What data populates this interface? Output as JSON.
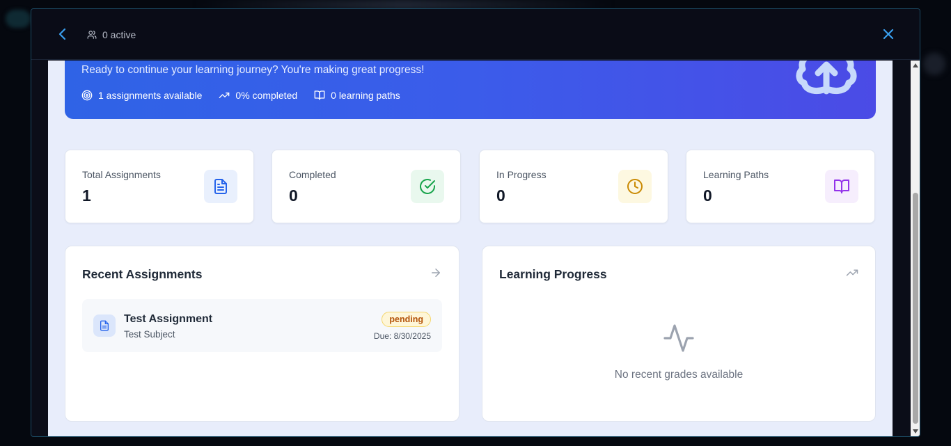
{
  "header": {
    "active_text": "0 active",
    "icons": [
      "chevron-left-icon",
      "users-icon",
      "close-icon"
    ]
  },
  "hero": {
    "subtitle": "Ready to continue your learning journey? You're making great progress!",
    "stats": [
      {
        "icon": "target-icon",
        "text": "1 assignments available"
      },
      {
        "icon": "trending-up-icon",
        "text": "0% completed"
      },
      {
        "icon": "book-open-icon",
        "text": "0 learning paths"
      }
    ],
    "decor_icon": "brain-icon"
  },
  "stat_cards": [
    {
      "label": "Total Assignments",
      "value": "1",
      "icon": "file-text-icon",
      "icon_color": "#2563eb",
      "icon_bg": "#e9f0fd"
    },
    {
      "label": "Completed",
      "value": "0",
      "icon": "check-circle-icon",
      "icon_color": "#16a34a",
      "icon_bg": "#e9f8ee"
    },
    {
      "label": "In Progress",
      "value": "0",
      "icon": "clock-icon",
      "icon_color": "#ca8a04",
      "icon_bg": "#fdf8e1"
    },
    {
      "label": "Learning Paths",
      "value": "0",
      "icon": "book-open-icon",
      "icon_color": "#9333ea",
      "icon_bg": "#f6eefd"
    }
  ],
  "recent_assignments": {
    "title": "Recent Assignments",
    "items": [
      {
        "title": "Test Assignment",
        "subject": "Test Subject",
        "status": "pending",
        "due": "Due: 8/30/2025"
      }
    ]
  },
  "learning_progress": {
    "title": "Learning Progress",
    "empty_text": "No recent grades available"
  },
  "colors": {
    "accent": "#2f63e6",
    "header_bg": "#0a0c17",
    "content_bg": "#e8edfb",
    "pending_badge": "#b45309"
  }
}
